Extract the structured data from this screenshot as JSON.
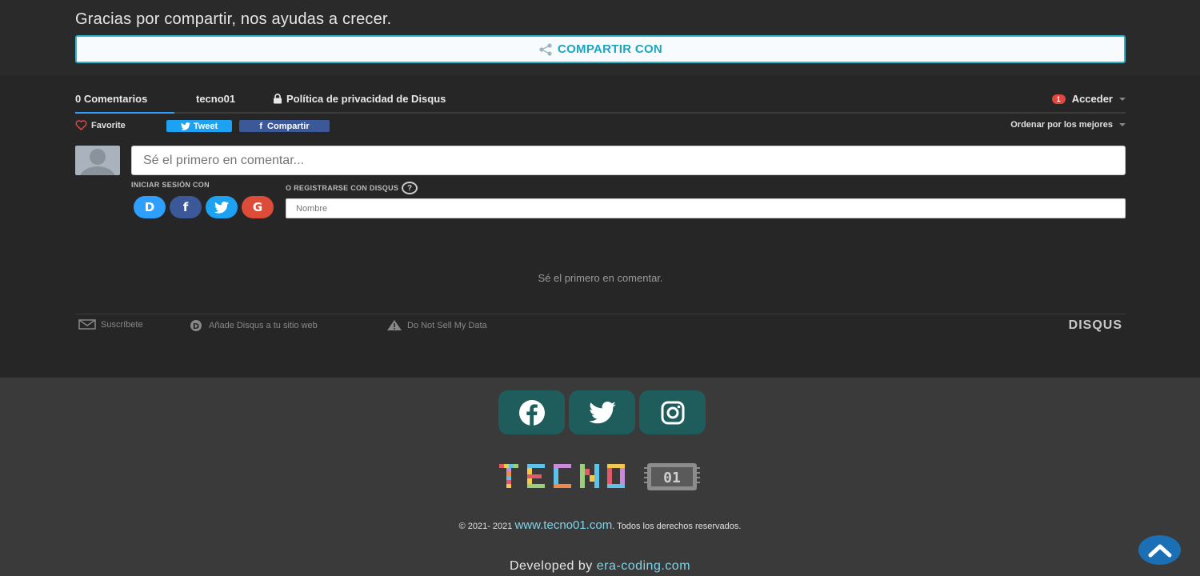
{
  "share": {
    "title": "Gracias por compartir, nos ayudas a crecer.",
    "button_label": "COMPARTIR CON"
  },
  "disqus": {
    "nav": {
      "comments": "0 Comentarios",
      "site": "tecno01",
      "privacy": "Política de privacidad de Disqus",
      "notifications": "1",
      "login": "Acceder"
    },
    "actions": {
      "favorite": "Favorite",
      "tweet": "Tweet",
      "share": "Compartir",
      "sort": "Ordenar por los mejores"
    },
    "comment_placeholder": "Sé el primero en comentar...",
    "login_with": "INICIAR SESIÓN CON",
    "login_services": [
      "D",
      "f",
      "twitter",
      "G"
    ],
    "register_label": "O REGISTRARSE CON DISQUS",
    "name_placeholder": "Nombre",
    "empty_message": "Sé el primero en comentar.",
    "footer": {
      "subscribe": "Suscríbete",
      "add_disqus": "Añade Disqus a tu sitio web",
      "do_not_sell": "Do Not Sell My Data",
      "brand": "DISQUS"
    }
  },
  "site_footer": {
    "social": [
      "facebook",
      "twitter",
      "instagram"
    ],
    "logo_text": "TECNO01",
    "copyright_prefix": "© 2021- 2021",
    "copyright_link": "www.tecno01.com",
    "copyright_suffix": ". Todos los derechos reservados.",
    "developed_prefix": "Developed by",
    "developed_link": "era-coding.com"
  },
  "colors": {
    "accent": "#2fb5c8",
    "twitter": "#1da1f2",
    "facebook": "#3b5998",
    "google": "#dd4b39",
    "disqus": "#2e9fff",
    "social_tile": "#1e5d5b",
    "link": "#7fd3ea"
  }
}
